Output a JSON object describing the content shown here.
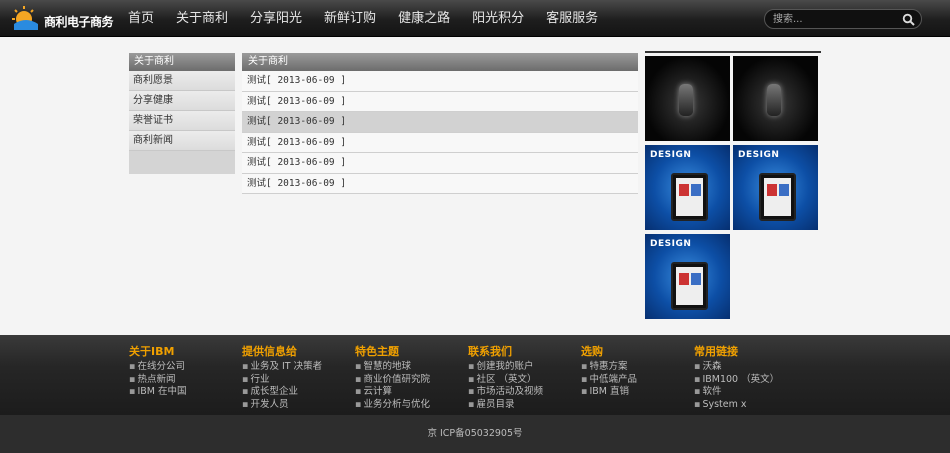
{
  "header": {
    "logo_text": "商利电子商务",
    "nav": [
      "首页",
      "关于商利",
      "分享阳光",
      "新鲜订购",
      "健康之路",
      "阳光积分",
      "客服服务"
    ],
    "search_placeholder": "搜索..."
  },
  "sidebar": {
    "title": "关于商利",
    "items": [
      "商利愿景",
      "分享健康",
      "荣誉证书",
      "商利新闻"
    ]
  },
  "list": {
    "title": "关于商利",
    "rows": [
      "测试[ 2013-06-09 ]",
      "测试[ 2013-06-09 ]",
      "测试[ 2013-06-09 ]",
      "测试[ 2013-06-09 ]",
      "测试[ 2013-06-09 ]",
      "测试[ 2013-06-09 ]"
    ],
    "active_row": 2
  },
  "gallery": {
    "thumbs": [
      "dark",
      "dark",
      "blue",
      "blue",
      "blue"
    ],
    "design_text": "DESIGN"
  },
  "footer": {
    "columns": [
      {
        "title": "关于IBM",
        "links": [
          "在线分公司",
          "热点新闻",
          "IBM 在中国"
        ]
      },
      {
        "title": "提供信息给",
        "links": [
          "业务及 IT 决策者",
          "行业",
          "成长型企业",
          "开发人员"
        ]
      },
      {
        "title": "特色主题",
        "links": [
          "智慧的地球",
          "商业价值研究院",
          "云计算",
          "业务分析与优化"
        ]
      },
      {
        "title": "联系我们",
        "links": [
          "创建我的账户",
          "社区 （英文）",
          "市场活动及视频",
          "雇员目录"
        ]
      },
      {
        "title": "选购",
        "links": [
          "特惠方案",
          "中低端产品",
          "IBM 直销"
        ]
      },
      {
        "title": "常用链接",
        "links": [
          "沃森",
          "IBM100 （英文）",
          "软件",
          "System x"
        ]
      }
    ],
    "copyright": "京 ICP备05032905号"
  },
  "colors": {
    "footer_title": "#f0a000",
    "accent_blue": "#0d4fa6"
  }
}
